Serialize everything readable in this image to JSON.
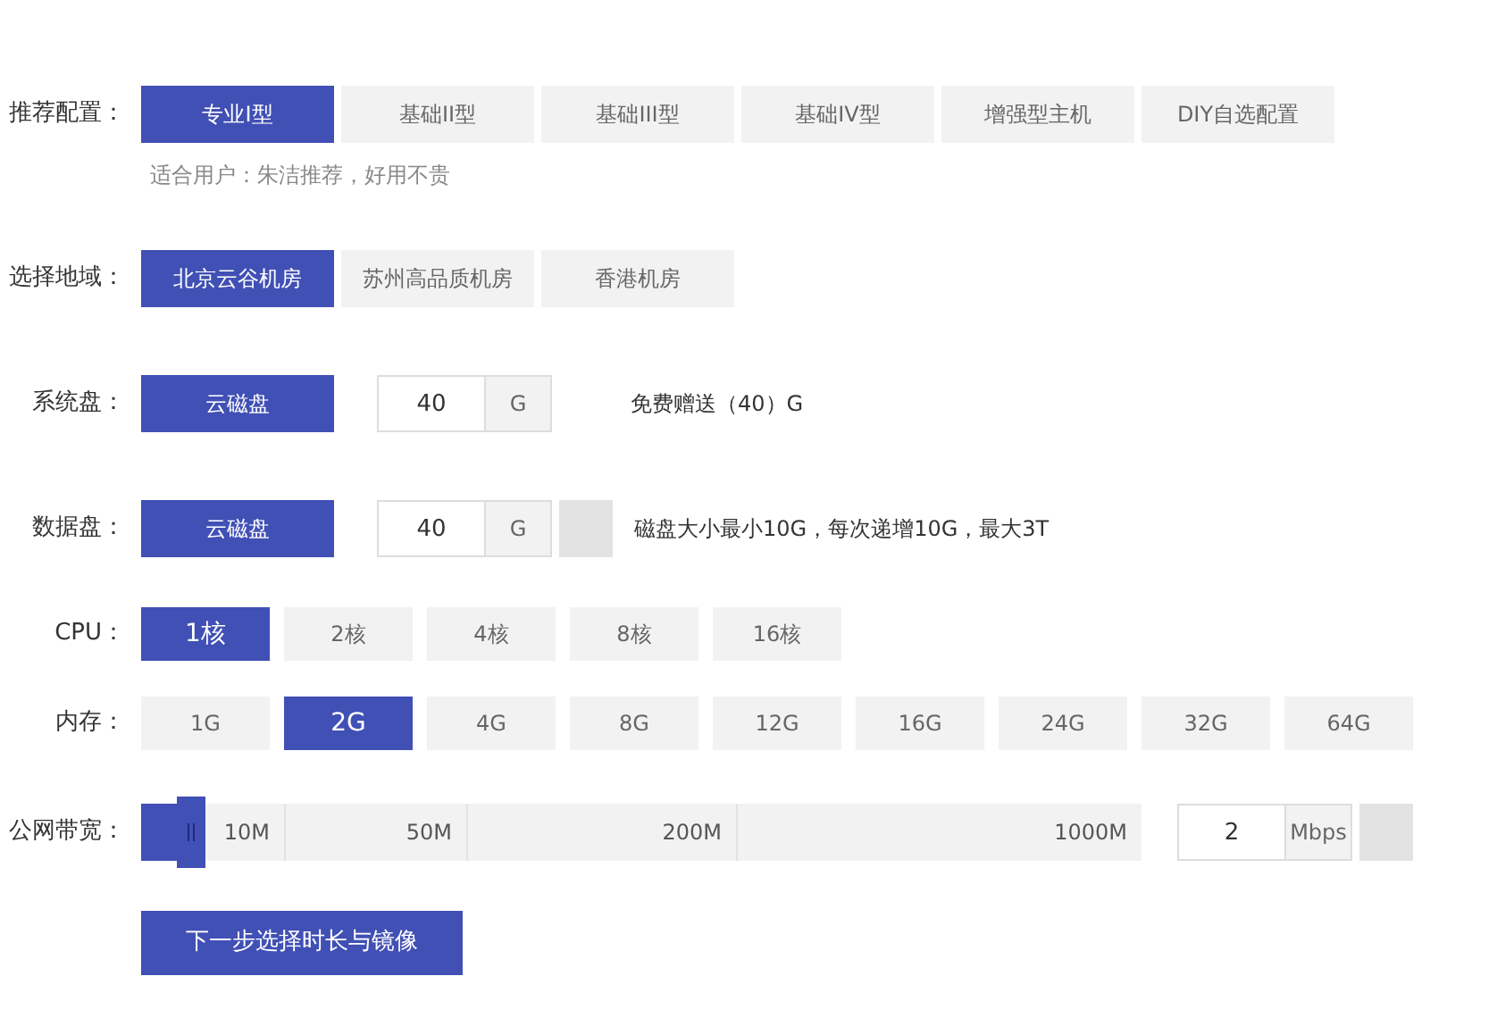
{
  "recommend": {
    "label": "推荐配置：",
    "options": [
      {
        "label": "专业I型",
        "selected": true
      },
      {
        "label": "基础II型",
        "selected": false
      },
      {
        "label": "基础III型",
        "selected": false
      },
      {
        "label": "基础IV型",
        "selected": false
      },
      {
        "label": "增强型主机",
        "selected": false
      },
      {
        "label": "DIY自选配置",
        "selected": false
      }
    ],
    "hint": "适合用户：朱洁推荐，好用不贵"
  },
  "region": {
    "label": "选择地域：",
    "options": [
      {
        "label": "北京云谷机房",
        "selected": true
      },
      {
        "label": "苏州高品质机房",
        "selected": false
      },
      {
        "label": "香港机房",
        "selected": false
      }
    ]
  },
  "system_disk": {
    "label": "系统盘：",
    "type_button": "云磁盘",
    "value": "40",
    "unit": "G",
    "note": "免费赠送（40）G"
  },
  "data_disk": {
    "label": "数据盘：",
    "type_button": "云磁盘",
    "value": "40",
    "unit": "G",
    "note": "磁盘大小最小10G，每次递增10G，最大3T"
  },
  "cpu": {
    "label": "CPU：",
    "options": [
      {
        "label": "1核",
        "selected": true
      },
      {
        "label": "2核",
        "selected": false
      },
      {
        "label": "4核",
        "selected": false
      },
      {
        "label": "8核",
        "selected": false
      },
      {
        "label": "16核",
        "selected": false
      }
    ]
  },
  "memory": {
    "label": "内存：",
    "options": [
      {
        "label": "1G",
        "selected": false
      },
      {
        "label": "2G",
        "selected": true
      },
      {
        "label": "4G",
        "selected": false
      },
      {
        "label": "8G",
        "selected": false
      },
      {
        "label": "12G",
        "selected": false
      },
      {
        "label": "16G",
        "selected": false
      },
      {
        "label": "24G",
        "selected": false
      },
      {
        "label": "32G",
        "selected": false
      },
      {
        "label": "64G",
        "selected": false
      }
    ]
  },
  "bandwidth": {
    "label": "公网带宽：",
    "level": 0.05,
    "ticks": [
      "10M",
      "50M",
      "200M",
      "1000M"
    ],
    "value": "2",
    "unit": "Mbps"
  },
  "next_button": "下一步选择时长与镜像"
}
